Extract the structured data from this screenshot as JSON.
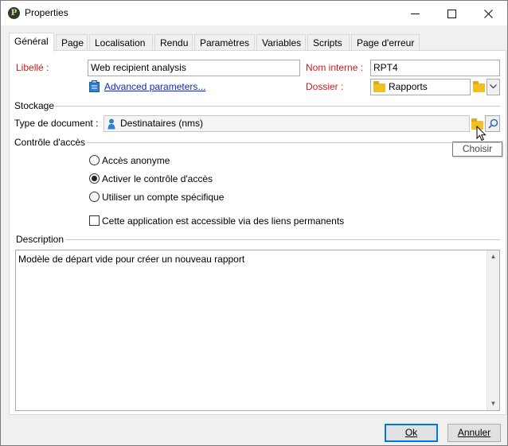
{
  "window": {
    "title": "Properties",
    "app_icon_letter": "P"
  },
  "tabs": [
    {
      "label": "Général",
      "active": true
    },
    {
      "label": "Page"
    },
    {
      "label": "Localisation"
    },
    {
      "label": "Rendu"
    },
    {
      "label": "Paramètres"
    },
    {
      "label": "Variables"
    },
    {
      "label": "Scripts"
    },
    {
      "label": "Page d'erreur"
    }
  ],
  "general": {
    "label_label": "Libellé :",
    "label_value": "Web recipient analysis",
    "internal_name_label": "Nom interne :",
    "internal_name_value": "RPT4",
    "advanced_link": "Advanced parameters...",
    "folder_label": "Dossier :",
    "folder_value": "Rapports"
  },
  "storage": {
    "section_title": "Stockage",
    "doc_type_label": "Type de document :",
    "doc_type_value": "Destinataires (nms)"
  },
  "access": {
    "section_title": "Contrôle d'accès",
    "options": [
      {
        "label": "Accès anonyme",
        "selected": false
      },
      {
        "label": "Activer le contrôle d'accès",
        "selected": true
      },
      {
        "label": "Utiliser un compte spécifique",
        "selected": false
      }
    ],
    "permanent_links_label": "Cette application est accessible via des liens permanents",
    "permanent_links_checked": false
  },
  "description": {
    "section_title": "Description",
    "text": "Modèle de départ vide pour créer un nouveau rapport"
  },
  "tooltip": {
    "text": "Choisir"
  },
  "buttons": {
    "ok": "Ok",
    "cancel": "Annuler"
  },
  "colors": {
    "required_label": "#d11a1a",
    "link": "#0a27c0",
    "folder": "#f2c01e",
    "default_button_border": "#0078d7"
  }
}
